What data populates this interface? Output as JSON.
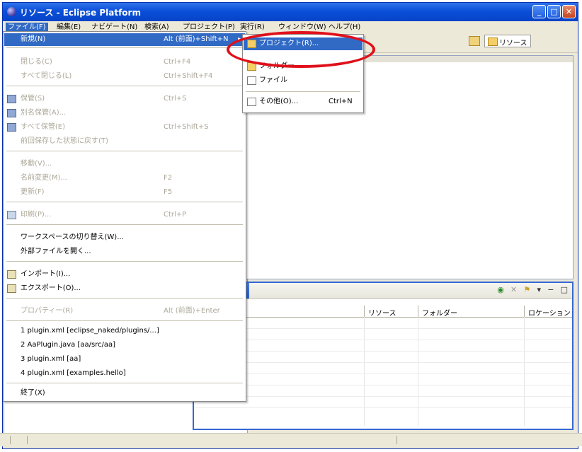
{
  "window": {
    "title": "リソース - Eclipse Platform",
    "controls": {
      "minimize": "_",
      "maximize": "□",
      "close": "✕"
    }
  },
  "menubar": {
    "items": [
      {
        "label": "ファイル(F)"
      },
      {
        "label": "編集(E)"
      },
      {
        "label": "ナビゲート(N)"
      },
      {
        "label": "検索(A)"
      },
      {
        "label": "プロジェクト(P)"
      },
      {
        "label": "実行(R)"
      },
      {
        "label": "ウィンドウ(W)"
      },
      {
        "label": "ヘルプ(H)"
      }
    ]
  },
  "perspective": {
    "label": "リソース"
  },
  "file_menu": {
    "new": {
      "label": "新規(N)",
      "shortcut": "Alt (前面)+Shift+N"
    },
    "close": {
      "label": "閉じる(C)",
      "shortcut": "Ctrl+F4"
    },
    "close_all": {
      "label": "すべて閉じる(L)",
      "shortcut": "Ctrl+Shift+F4"
    },
    "save": {
      "label": "保管(S)",
      "shortcut": "Ctrl+S"
    },
    "save_as": {
      "label": "別名保管(A)..."
    },
    "save_all": {
      "label": "すべて保管(E)",
      "shortcut": "Ctrl+Shift+S"
    },
    "revert": {
      "label": "前回保存した状態に戻す(T)"
    },
    "move": {
      "label": "移動(V)..."
    },
    "rename": {
      "label": "名前変更(M)...",
      "shortcut": "F2"
    },
    "refresh": {
      "label": "更新(F)",
      "shortcut": "F5"
    },
    "print": {
      "label": "印刷(P)...",
      "shortcut": "Ctrl+P"
    },
    "switch_workspace": {
      "label": "ワークスペースの切り替え(W)..."
    },
    "open_external": {
      "label": "外部ファイルを開く..."
    },
    "import": {
      "label": "インポート(I)..."
    },
    "export": {
      "label": "エクスポート(O)..."
    },
    "properties": {
      "label": "プロパティー(R)",
      "shortcut": "Alt (前面)+Enter"
    },
    "recent": [
      {
        "label": "1 plugin.xml  [eclipse_naked/plugins/...]"
      },
      {
        "label": "2 AaPlugin.java  [aa/src/aa]"
      },
      {
        "label": "3 plugin.xml  [aa]"
      },
      {
        "label": "4 plugin.xml  [examples.hello]"
      }
    ],
    "exit": {
      "label": "終了(X)"
    }
  },
  "new_submenu": {
    "project": {
      "label": "プロジェクト(R)..."
    },
    "folder": {
      "label": "フォルダー"
    },
    "file": {
      "label": "ファイル"
    },
    "other": {
      "label": "その他(O)...",
      "shortcut": "Ctrl+N"
    }
  },
  "problems_view": {
    "columns": [
      "リソース",
      "フォルダー",
      "ロケーション"
    ]
  },
  "colors": {
    "highlight": "#316ac5",
    "annotation_circle": "#e0101a",
    "titlebar": "#0a4fd8"
  }
}
